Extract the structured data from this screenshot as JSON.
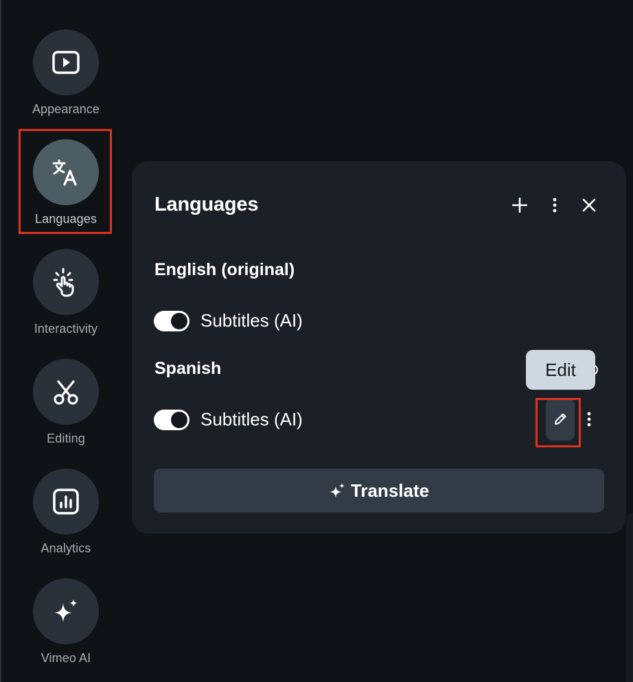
{
  "sidebar": {
    "items": [
      {
        "label": "Appearance",
        "icon": "play-box-icon",
        "active": false
      },
      {
        "label": "Languages",
        "icon": "translate-icon",
        "active": true
      },
      {
        "label": "Interactivity",
        "icon": "hand-tap-icon",
        "active": false
      },
      {
        "label": "Editing",
        "icon": "scissors-icon",
        "active": false
      },
      {
        "label": "Analytics",
        "icon": "bar-chart-icon",
        "active": false
      },
      {
        "label": "Vimeo AI",
        "icon": "sparkle-icon",
        "active": false
      }
    ]
  },
  "panel": {
    "title": "Languages",
    "actions": [
      "plus-icon",
      "more-vertical-icon",
      "close-icon"
    ],
    "languages": [
      {
        "name": "English (original)",
        "tracks": [
          {
            "label": "Subtitles (AI)",
            "enabled": true
          }
        ]
      },
      {
        "name": "Spanish",
        "tracks": [
          {
            "label": "Subtitles (AI)",
            "enabled": true
          }
        ]
      }
    ],
    "tooltip": "Edit",
    "translate_label": "Translate"
  },
  "colors": {
    "background": "#101316",
    "panel": "#1b2027",
    "nav_circle": "#2b3138",
    "nav_circle_active": "#4c5d64",
    "button": "#333c46",
    "highlight": "#e1311f",
    "tooltip": "#cfd8e0"
  }
}
